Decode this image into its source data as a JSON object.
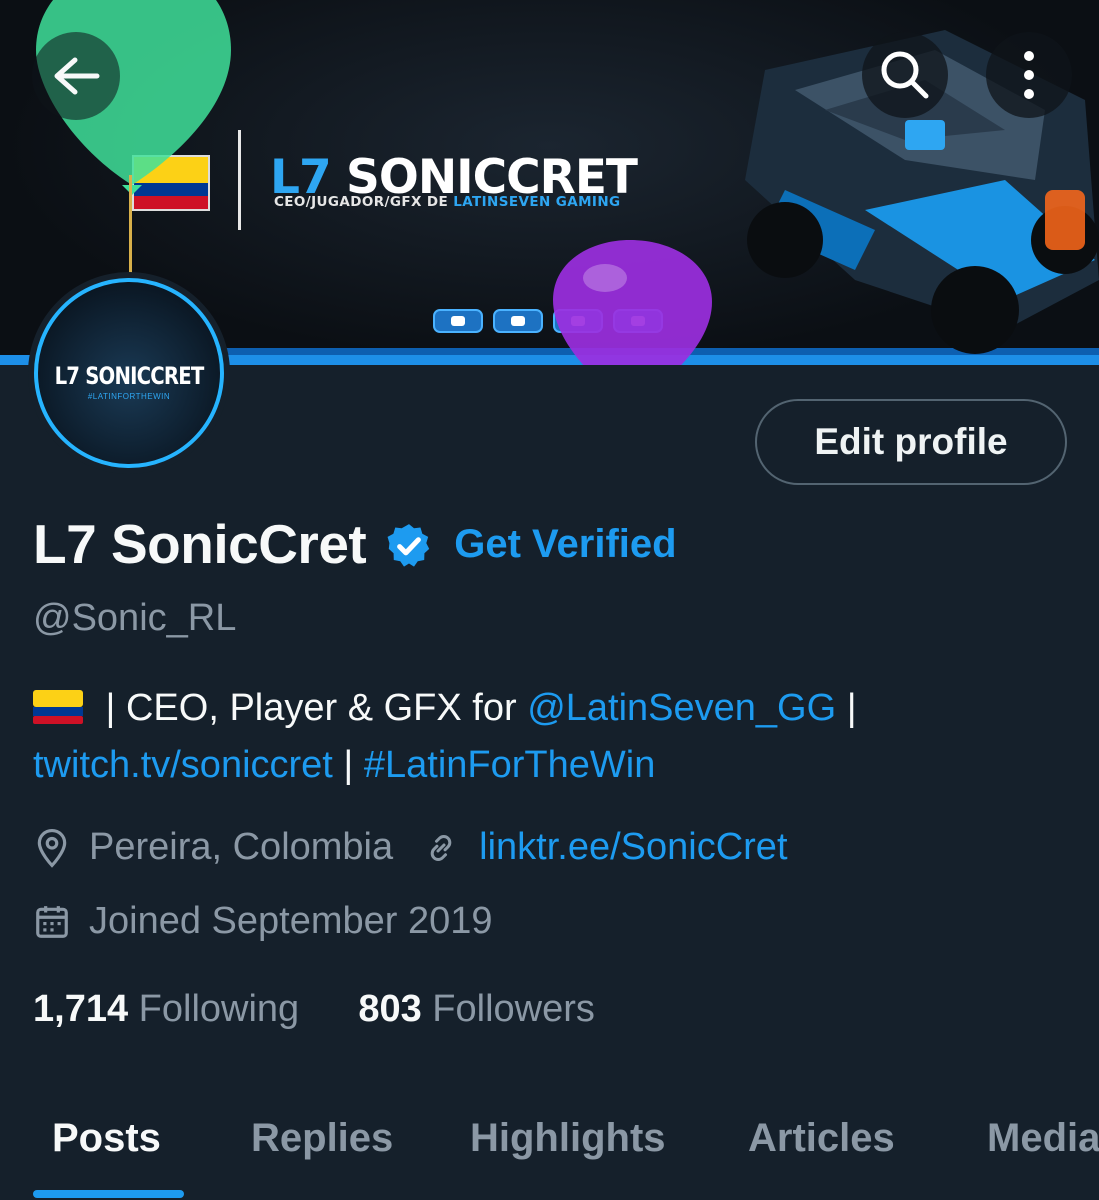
{
  "banner": {
    "brand_prefix": "L7",
    "brand_name": " SONICCRET",
    "brand_subtitle_part1": "CEO/JUGADOR/GFX DE ",
    "brand_subtitle_part2": "LATINSEVEN GAMING"
  },
  "header": {
    "back_icon": "arrow-left-icon",
    "search_icon": "search-icon",
    "more_icon": "more-vertical-icon"
  },
  "avatar": {
    "text": "L7 SONICCRET",
    "subtext": "#LATINFORTHEWIN"
  },
  "edit_profile_label": "Edit profile",
  "profile": {
    "display_name": "L7 SonicCret",
    "get_verified_label": "Get Verified",
    "handle": "@Sonic_RL",
    "bio_part1": " | CEO, Player & GFX for ",
    "bio_mention": "@LatinSeven_GG",
    "bio_part2": " |",
    "bio_link": "twitch.tv/soniccret",
    "bio_sep": " | ",
    "bio_hashtag": "#LatinForTheWin",
    "location": "Pereira, Colombia",
    "website": "linktr.ee/SonicCret",
    "joined": "Joined September 2019"
  },
  "stats": {
    "following_count": "1,714",
    "following_label": "Following",
    "followers_count": "803",
    "followers_label": "Followers"
  },
  "tabs": [
    {
      "label": "Posts",
      "active": true
    },
    {
      "label": "Replies",
      "active": false
    },
    {
      "label": "Highlights",
      "active": false
    },
    {
      "label": "Articles",
      "active": false
    },
    {
      "label": "Media",
      "active": false
    }
  ],
  "colors": {
    "background": "#15202b",
    "accent": "#1d9bf0",
    "muted": "#8b98a5",
    "text": "#f7f9f9"
  }
}
